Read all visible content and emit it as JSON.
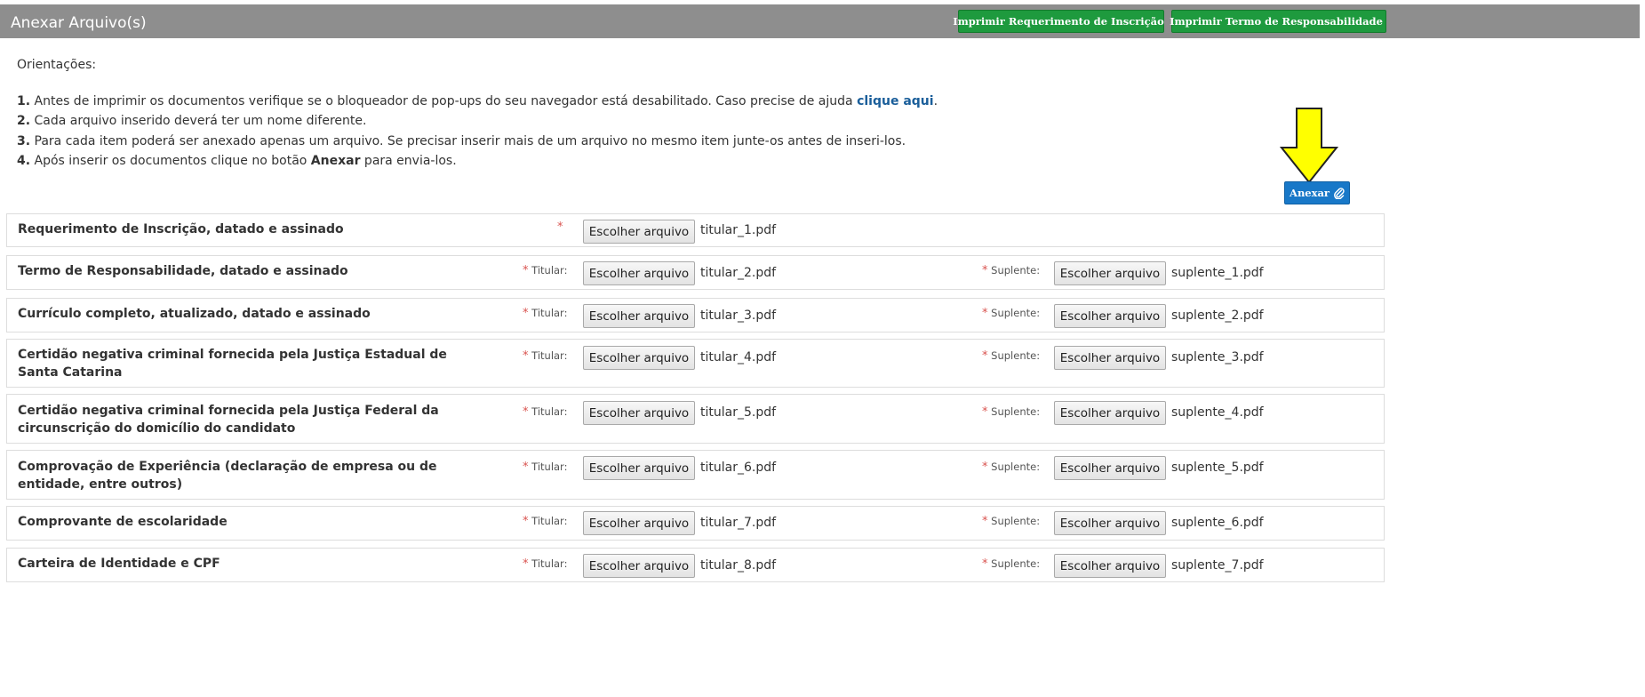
{
  "header": {
    "title": "Anexar Arquivo(s)",
    "print_request_label": "Imprimir Requerimento de Inscrição",
    "print_term_label": "Imprimir Termo de Responsabilidade"
  },
  "orientations": {
    "title": "Orientações:",
    "items": [
      {
        "num": "1.",
        "text": " Antes de imprimir os documentos verifique se o bloqueador de pop-ups do seu navegador está desabilitado. Caso precise de ajuda ",
        "link": "clique aqui",
        "after": "."
      },
      {
        "num": "2.",
        "text": " Cada arquivo inserido deverá ter um nome diferente."
      },
      {
        "num": "3.",
        "text": " Para cada item poderá ser anexado apenas um arquivo. Se precisar inserir mais de um arquivo no mesmo item junte-os antes de inseri-los."
      },
      {
        "num": "4.",
        "text": " Após inserir os documentos clique no botão ",
        "bold": "Anexar",
        "after": " para envia-los."
      }
    ]
  },
  "attach_button_label": "Anexar",
  "required_mark": "*",
  "titular_label": "Titular:",
  "suplente_label": "Suplente:",
  "choose_file_label": "Escolher arquivo",
  "colors": {
    "header": "#8e8e8e",
    "green": "#1e9a3e",
    "blue": "#1878c8",
    "arrow": "#ffff00"
  },
  "rows": [
    {
      "label": "Requerimento de Inscrição, datado e assinado",
      "titular_file": "titular_1.pdf"
    },
    {
      "label": "Termo de Responsabilidade, datado e assinado",
      "titular_file": "titular_2.pdf",
      "suplente_file": "suplente_1.pdf"
    },
    {
      "label": "Currículo completo, atualizado, datado e assinado",
      "titular_file": "titular_3.pdf",
      "suplente_file": "suplente_2.pdf"
    },
    {
      "label": "Certidão negativa criminal fornecida pela Justiça Estadual de Santa Catarina",
      "titular_file": "titular_4.pdf",
      "suplente_file": "suplente_3.pdf"
    },
    {
      "label": "Certidão negativa criminal fornecida pela Justiça Federal da circunscrição do domicílio do candidato",
      "titular_file": "titular_5.pdf",
      "suplente_file": "suplente_4.pdf"
    },
    {
      "label": "Comprovação de Experiência (declaração de empresa ou de entidade, entre outros)",
      "titular_file": "titular_6.pdf",
      "suplente_file": "suplente_5.pdf"
    },
    {
      "label": "Comprovante de escolaridade",
      "titular_file": "titular_7.pdf",
      "suplente_file": "suplente_6.pdf"
    },
    {
      "label": "Carteira de Identidade e CPF",
      "titular_file": "titular_8.pdf",
      "suplente_file": "suplente_7.pdf"
    }
  ]
}
